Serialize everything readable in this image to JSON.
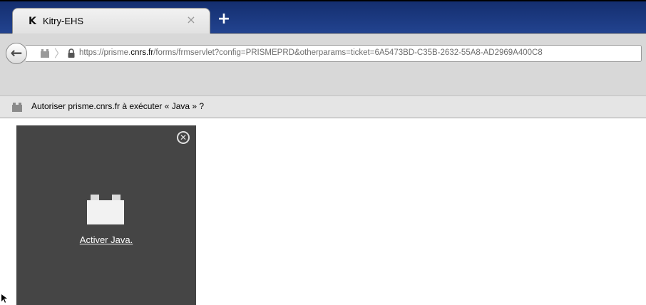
{
  "browser": {
    "tab": {
      "favicon": "K",
      "title": "Kitry-EHS",
      "close_icon": "×"
    },
    "new_tab_icon": "+",
    "nav": {
      "back_icon": "←",
      "separator": "〉",
      "url_prefix": "https://prisme.",
      "url_domain": "cnrs.fr",
      "url_rest": "/forms/frmservlet?config=PRISMEPRD&otherparams=ticket=6A5473BD-C35B-2632-55A8-AD2969A400C8"
    }
  },
  "notification": {
    "text": "Autoriser prisme.cnrs.fr à exécuter « Java » ?"
  },
  "plugin_panel": {
    "close_icon": "✕",
    "link_text": "Activer Java."
  },
  "colors": {
    "tabstrip": "#1c3a80",
    "panel": "#454545",
    "navbar": "#d8d8d8"
  }
}
